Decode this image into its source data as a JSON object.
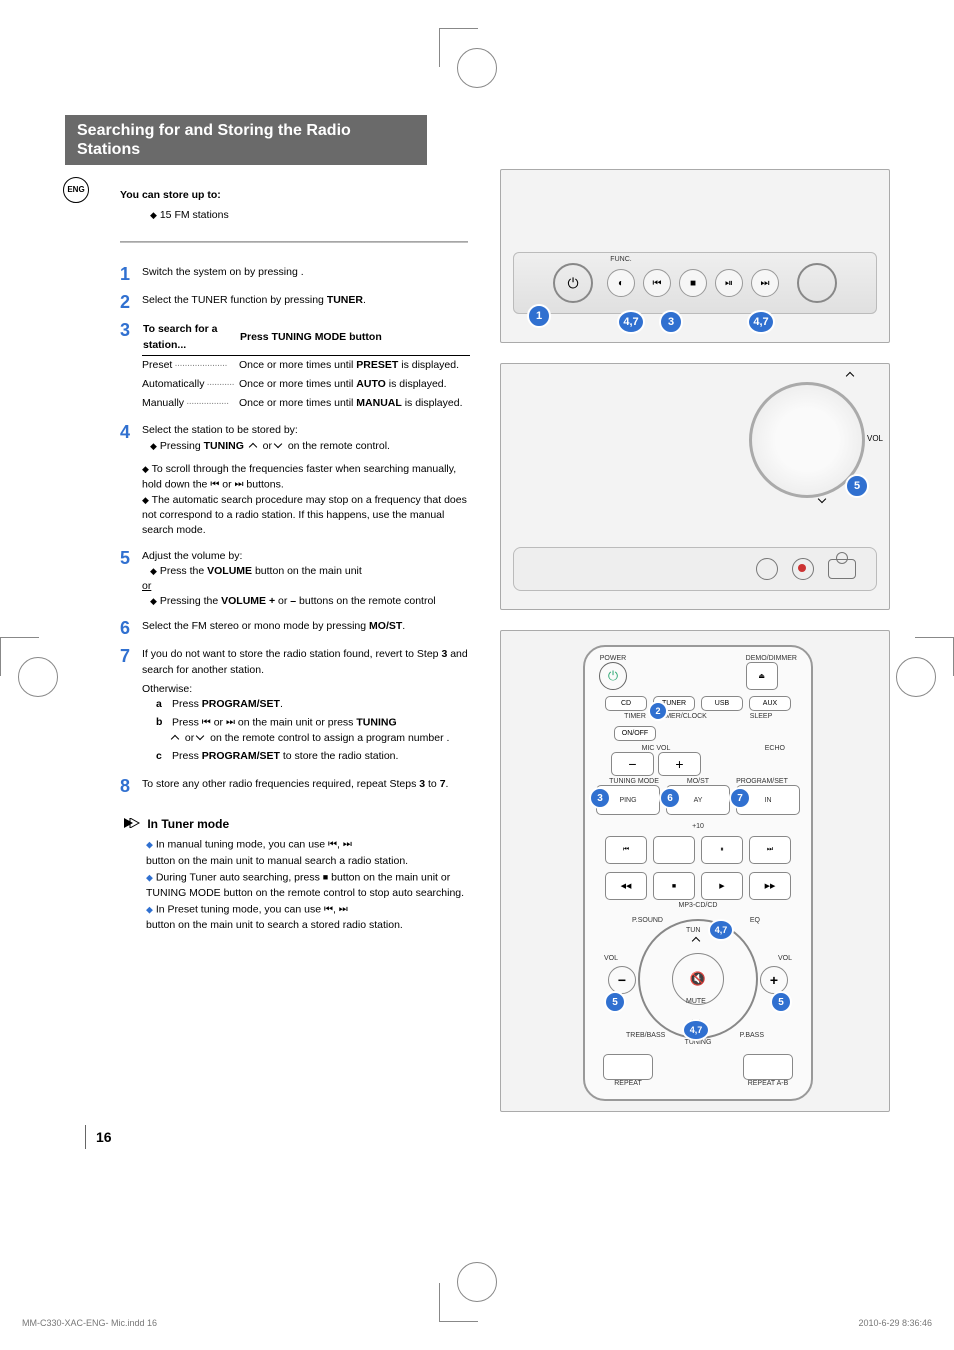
{
  "eng_badge": "ENG",
  "title_line1": "Searching for and Storing the Radio",
  "title_line2": "Stations",
  "intro": "You can store up to:",
  "intro_bullet": "15 FM stations",
  "steps": {
    "s1": "Switch the system on by pressing           .",
    "s2_a": "Select the TUNER function by pressing ",
    "s2_b": "TUNER",
    "s2_c": ".",
    "s3_head_left": "To search for a station...",
    "s3_head_right": "Press TUNING MODE button",
    "s3_r1_k": "Preset",
    "s3_r1_v_a": "Once or more times until ",
    "s3_r1_v_b": "PRESET",
    "s3_r1_v_c": " is displayed.",
    "s3_r2_k": "Automatically",
    "s3_r2_v_a": "Once or more times until ",
    "s3_r2_v_b": "AUTO",
    "s3_r2_v_c": "  is displayed.",
    "s3_r3_k": "Manually",
    "s3_r3_v_a": "Once or more times until ",
    "s3_r3_v_b": "MANUAL",
    "s3_r3_v_c": " is displayed.",
    "s4_a": "Select the station to be stored by:",
    "s4_b": "Pressing ",
    "s4_c": "TUNING",
    "s4_d": "  or  ",
    "s4_e": "  on the remote control.",
    "s4_note1_a": "To scroll through the frequencies faster when searching manually, hold down the ",
    "s4_note1_b": " or ",
    "s4_note1_c": " buttons.",
    "s4_note2": "The automatic search procedure may stop on a frequency that does not correspond to a radio station. If this happens, use the manual search mode.",
    "s5_a": "Adjust the volume by:",
    "s5_b": "Press the ",
    "s5_c": "VOLUME",
    "s5_d": " button on the main unit",
    "s5_or": "or",
    "s5_e": "Pressing the ",
    "s5_f": "VOLUME +",
    "s5_g": " or ",
    "s5_h": "–",
    "s5_i": " buttons on the remote control",
    "s6_a": "Select the FM stereo or mono mode by pressing ",
    "s6_b": "MO/ST",
    "s6_c": ".",
    "s7_a": "If you do not want to store the radio station found, revert to Step ",
    "s7_b": "3",
    "s7_c": " and search for another station.",
    "s7_other": "Otherwise:",
    "s7_a_key": "a",
    "s7_a_txt_a": "Press ",
    "s7_a_txt_b": "PROGRAM/SET",
    "s7_a_txt_c": ".",
    "s7_b_key": "b",
    "s7_b_txt_a": "Press ",
    "s7_b_txt_b": " or ",
    "s7_b_txt_c": " on the main unit or press ",
    "s7_b_txt_d": "TUNING",
    "s7_b_txt_e": " or ",
    "s7_b_txt_f": " on the remote control to assign a program number .",
    "s7_c_key": "c",
    "s7_c_txt_a": "Press ",
    "s7_c_txt_b": "PROGRAM/SET",
    "s7_c_txt_c": " to store the radio station.",
    "s8_a": "To store any other radio frequencies required, repeat Steps ",
    "s8_b": "3",
    "s8_c": " to ",
    "s8_d": "7",
    "s8_e": "."
  },
  "tuner_mode": {
    "heading": "In Tuner mode",
    "b1_a": "In manual tuning mode, you can use ",
    "b1_b": "button on the main unit to manual search a radio station.",
    "b2_a": "During Tuner auto searching, press ",
    "b2_b": " button on the main unit or TUNING MODE button on the remote control to stop auto searching.",
    "b3_a": "In Preset tuning mode, you can use ",
    "b3_b": "button on the main unit to search a stored radio station."
  },
  "fig1": {
    "func": "FUNC.",
    "badges": {
      "b1": "1",
      "b47a": "4,7",
      "b3": "3",
      "b47b": "4,7"
    }
  },
  "fig2": {
    "vol": "VOL",
    "badge5": "5"
  },
  "remote": {
    "power": "POWER",
    "demo": "DEMO/DIMMER",
    "cd": "CD",
    "tuner": "TUNER",
    "usb": "USB",
    "aux": "AUX",
    "timer": "TIMER",
    "timerclock": "TIMER/CLOCK",
    "sleep": "SLEEP",
    "onoff": "ON/OFF",
    "micvol": "MIC VOL",
    "echo": "ECHO",
    "tuningmode": "TUNING MODE",
    "most": "MO/ST",
    "progset": "PROGRAM/SET",
    "eqping": "PING",
    "eqay": "AY",
    "eqin": "IN",
    "plus10": "+10",
    "mp3": "MP3-CD/CD",
    "psound": "P.SOUND",
    "eq": "EQ",
    "tun": "TUN",
    "volL": "VOL",
    "volR": "VOL",
    "mute": "MUTE",
    "trebbass": "TREB/BASS",
    "pbass": "P.BASS",
    "tuning": "TUNING",
    "repeat": "REPEAT",
    "repeatab": "REPEAT A-B",
    "b2": "2",
    "b3": "3",
    "b6": "6",
    "b7": "7",
    "b47": "4,7",
    "b5a": "5",
    "b5b": "5",
    "b47b": "4,7"
  },
  "pagenum": "16",
  "footer_path": "MM-C330-XAC-ENG- Mic.indd   16",
  "footer_date": "2010-6-29   8:36:46"
}
